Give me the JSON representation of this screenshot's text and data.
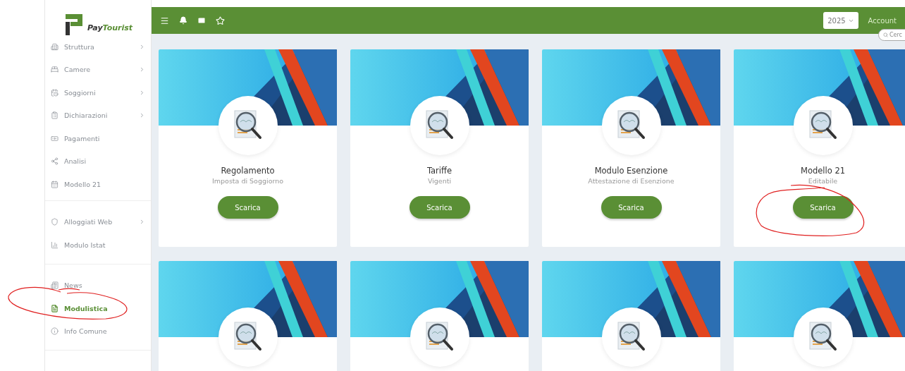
{
  "logo": {
    "part_1": "Pay",
    "part_2": "Tourist"
  },
  "topbar": {
    "year": "2025",
    "account": "Account",
    "search": {
      "placeholder": "Cerc"
    }
  },
  "sidebar": {
    "sections": [
      {
        "items": [
          {
            "label": "Struttura",
            "chevron": true,
            "selected": false
          },
          {
            "label": "Camere",
            "chevron": true,
            "selected": false
          },
          {
            "label": "Soggiorni",
            "chevron": true,
            "selected": false
          },
          {
            "label": "Dichiarazioni",
            "chevron": true,
            "selected": false
          },
          {
            "label": "Pagamenti",
            "chevron": false,
            "selected": false
          },
          {
            "label": "Analisi",
            "chevron": false,
            "selected": false
          },
          {
            "label": "Modello 21",
            "chevron": false,
            "selected": false
          }
        ]
      },
      {
        "items": [
          {
            "label": "Alloggiati Web",
            "chevron": true,
            "selected": false
          },
          {
            "label": "Modulo Istat",
            "chevron": false,
            "selected": false
          }
        ]
      },
      {
        "items": [
          {
            "label": "News",
            "chevron": false,
            "selected": false
          },
          {
            "label": "Modulistica",
            "chevron": false,
            "selected": true
          },
          {
            "label": "Info Comune",
            "chevron": false,
            "selected": false
          }
        ]
      }
    ]
  },
  "cards": [
    {
      "kind": "download",
      "title": "Regolamento",
      "subtitle": "Imposta di Soggiorno",
      "button": "Scarica"
    },
    {
      "kind": "download",
      "title": "Tariffe",
      "subtitle": "Vigenti",
      "button": "Scarica"
    },
    {
      "kind": "download",
      "title": "Modulo Esenzione",
      "subtitle": "Attestazione di Esenzione",
      "button": "Scarica"
    },
    {
      "kind": "download",
      "title": "Modello 21",
      "subtitle": "Editabile",
      "button": "Scarica"
    },
    {
      "kind": "cut_off"
    },
    {
      "kind": "cut_off"
    },
    {
      "kind": "cut_off"
    },
    {
      "kind": "cut_off"
    }
  ]
}
